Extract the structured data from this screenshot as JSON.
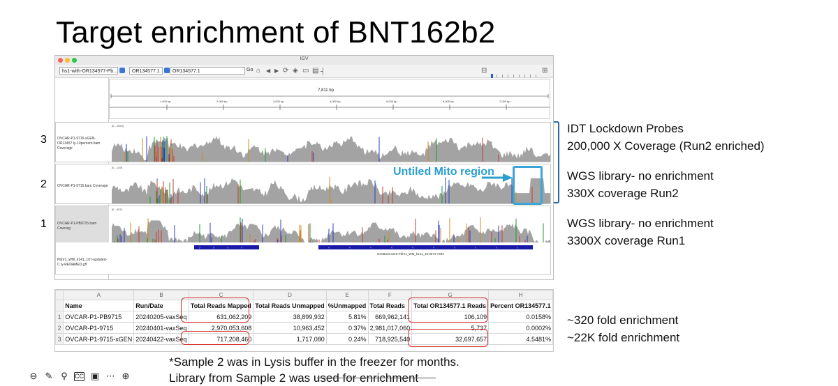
{
  "slide": {
    "title": "Target enrichment of  BNT162b2"
  },
  "igv": {
    "window_title": "IGV",
    "genome": "hs1-with-OR134577-Pb...",
    "chromosome": "OR134577.1",
    "locus": "OR134577.1",
    "go_label": "Go",
    "ruler": {
      "span": "7,811 bp",
      "ticks": [
        "1,000 bp",
        "2,000 bp",
        "3,000 bp",
        "4,000 bp",
        "5,000 bp",
        "6,000 bp",
        "7,000 bp"
      ]
    },
    "tracks": [
      {
        "number": "3",
        "label": "OVCAR-P1-9715-xGEN-OR13457 ly-10percent.bam Coverage",
        "range": "[0 - 2020]"
      },
      {
        "number": "2",
        "label": "OVCAR-P1-9715.bam Coverage",
        "range": "[0 - 129]"
      },
      {
        "number": "1",
        "label": "OVCAR-P1-PB9715.bam Coverag",
        "range": "[0 - 907]"
      }
    ],
    "feature_label": "Pbhr1_WM_k141_107-updated-C ly-RENAMED.gff",
    "feature_annotation": "GenBank:CDS:Pbhr1_WM_k141_10:3674-7493"
  },
  "annotations": {
    "untiled": "Untiled Mito region",
    "track3": [
      "IDT Lockdown Probes",
      "200,000 X Coverage (Run2 enriched)"
    ],
    "track2": [
      "WGS library- no enrichment",
      "330X coverage Run2"
    ],
    "track1": [
      "WGS library- no enrichment",
      "3300X coverage Run1"
    ]
  },
  "sheet": {
    "col_letters": [
      "A",
      "B",
      "C",
      "D",
      "E",
      "F",
      "G",
      "H"
    ],
    "headers": [
      "Name",
      "Run/Date",
      "Total Reads Mapped",
      "Total Reads Unmapped",
      "%Unmapped",
      "Total Reads",
      "Total OR134577.1 Reads",
      "Percent OR134577.1"
    ],
    "rows": [
      {
        "n": "1",
        "cells": [
          "OVCAR-P1-PB9715",
          "20240205-vaxSeq",
          "631,062,209",
          "38,899,932",
          "5.81%",
          "669,962,141",
          "106,109",
          "0.0158%"
        ]
      },
      {
        "n": "2",
        "cells": [
          "OVCAR-P1-9715",
          "20240401-vaxSeq",
          "2,970,053,608",
          "10,963,452",
          "0.37%",
          "2,981,017,060",
          "5,737",
          "0.0002%"
        ]
      },
      {
        "n": "3",
        "cells": [
          "OVCAR-P1-9715-xGEN",
          "20240422-vaxSeq",
          "717,208,460",
          "1,717,080",
          "0.24%",
          "718,925,540",
          "32,697,657",
          "4.5481%"
        ]
      }
    ]
  },
  "fold": [
    "~320 fold enrichment",
    "~22K fold enrichment"
  ],
  "notes": [
    "*Sample 2 was in Lysis buffer in the freezer for months.",
    "Library from Sample 2 was used for enrichment"
  ],
  "colors": {
    "accent": "#2b9fcf",
    "highlight": "#d2302c",
    "coverage": "#a3a3a3"
  }
}
